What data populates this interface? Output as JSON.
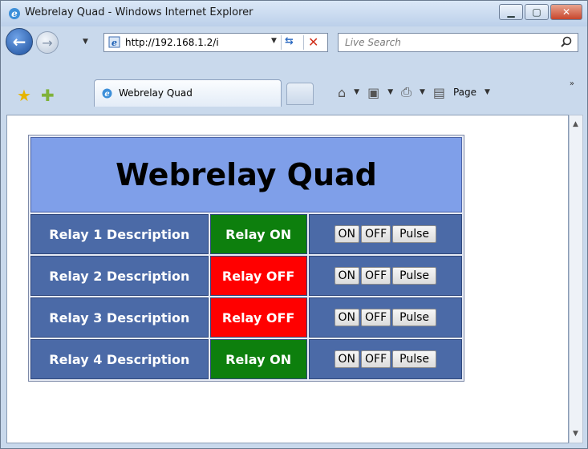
{
  "window": {
    "title": "Webrelay Quad - Windows Internet Explorer"
  },
  "nav": {
    "address": "http://192.168.1.2/i",
    "search_placeholder": "Live Search"
  },
  "tabs": [
    {
      "label": "Webrelay Quad"
    }
  ],
  "toolbar": {
    "page_label": "Page"
  },
  "page": {
    "heading": "Webrelay Quad",
    "relays": [
      {
        "description": "Relay 1 Description",
        "status": "Relay ON",
        "state": "on",
        "on": "ON",
        "off": "OFF",
        "pulse": "Pulse"
      },
      {
        "description": "Relay 2 Description",
        "status": "Relay OFF",
        "state": "off",
        "on": "ON",
        "off": "OFF",
        "pulse": "Pulse"
      },
      {
        "description": "Relay 3 Description",
        "status": "Relay OFF",
        "state": "off",
        "on": "ON",
        "off": "OFF",
        "pulse": "Pulse"
      },
      {
        "description": "Relay 4 Description",
        "status": "Relay ON",
        "state": "on",
        "on": "ON",
        "off": "OFF",
        "pulse": "Pulse"
      }
    ]
  },
  "colors": {
    "relay_on": "#0d7f0d",
    "relay_off": "#ff0000",
    "header_bg": "#7f9fe9",
    "row_bg": "#4b6aa7"
  }
}
